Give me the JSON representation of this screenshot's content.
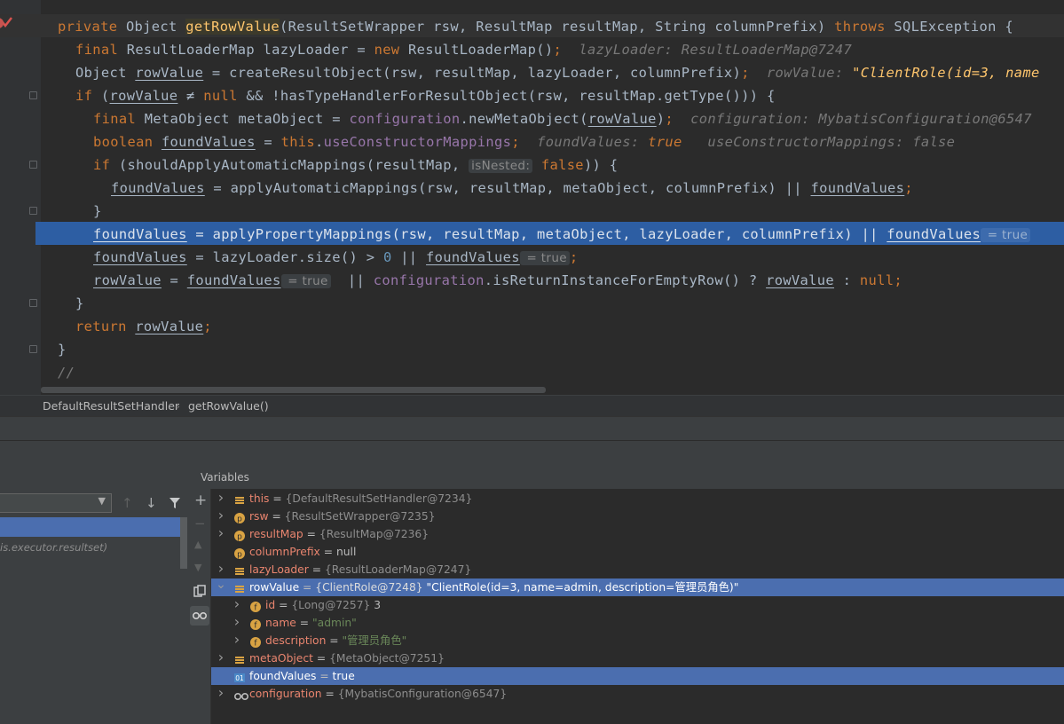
{
  "editor": {
    "lines": [
      {
        "id": "l1",
        "parts": [
          [
            "private ",
            "kw"
          ],
          [
            "Object ",
            ""
          ],
          [
            "getRowValue",
            "fn mbreak"
          ],
          [
            "(ResultSetWrapper rsw, ResultMap resultMap, String columnPrefix) ",
            ""
          ],
          [
            "throws ",
            "kw"
          ],
          [
            "SQLException {",
            ""
          ]
        ]
      },
      {
        "id": "l2",
        "parts": [
          [
            "final ",
            "kw"
          ],
          [
            "ResultLoaderMap lazyLoader = ",
            ""
          ],
          [
            "new ",
            "kw"
          ],
          [
            "ResultLoaderMap()",
            ""
          ],
          [
            ";",
            "kw"
          ],
          [
            "  lazyLoader: ResultLoaderMap@7247",
            "hint"
          ]
        ]
      },
      {
        "id": "l3",
        "parts": [
          [
            "Object ",
            ""
          ],
          [
            "rowValue",
            "u"
          ],
          [
            " = createResultObject(rsw, resultMap, lazyLoader, columnPrefix)",
            ""
          ],
          [
            ";",
            "kw"
          ],
          [
            "  rowValue: ",
            "hint"
          ],
          [
            "\"ClientRole(id=3, name",
            "hintstr"
          ]
        ]
      },
      {
        "id": "l4",
        "parts": [
          [
            "if ",
            "kw"
          ],
          [
            "(",
            ""
          ],
          [
            "rowValue",
            "u"
          ],
          [
            " ≠ ",
            ""
          ],
          [
            "null ",
            "kw"
          ],
          [
            "&& !hasTypeHandlerForResultObject(rsw, resultMap.getType())) {",
            ""
          ]
        ]
      },
      {
        "id": "l5",
        "parts": [
          [
            "final ",
            "kw"
          ],
          [
            "MetaObject metaObject = ",
            ""
          ],
          [
            "configuration",
            "fld"
          ],
          [
            ".newMetaObject(",
            ""
          ],
          [
            "rowValue",
            "u"
          ],
          [
            ")",
            ""
          ],
          [
            ";",
            "kw"
          ],
          [
            "  configuration: MybatisConfiguration@6547",
            "hint"
          ]
        ]
      },
      {
        "id": "l6",
        "parts": [
          [
            "boolean ",
            "kw"
          ],
          [
            "foundValues",
            "u"
          ],
          [
            " = ",
            ""
          ],
          [
            "this",
            "kw"
          ],
          [
            ".",
            ""
          ],
          [
            "useConstructorMappings",
            "fld"
          ],
          [
            ";",
            "kw"
          ],
          [
            "  foundValues: ",
            "hint"
          ],
          [
            "true",
            "hintval"
          ],
          [
            "   useConstructorMappings: false",
            "hint"
          ]
        ]
      },
      {
        "id": "l7",
        "parts": [
          [
            "if ",
            "kw"
          ],
          [
            "(shouldApplyAutomaticMappings(resultMap, ",
            ""
          ],
          [
            "isNested:",
            "pill"
          ],
          [
            " ",
            ""
          ],
          [
            "false",
            "kw"
          ],
          [
            ")) {",
            ""
          ]
        ]
      },
      {
        "id": "l8",
        "parts": [
          [
            "foundValues",
            "u"
          ],
          [
            " = applyAutomaticMappings(rsw, resultMap, metaObject, columnPrefix) || ",
            ""
          ],
          [
            "foundValues",
            "u"
          ],
          [
            ";",
            "kw"
          ]
        ]
      },
      {
        "id": "l9",
        "parts": [
          [
            "}",
            ""
          ]
        ]
      },
      {
        "id": "l10",
        "parts": [
          [
            "foundValues",
            "u"
          ],
          [
            " = applyPropertyMappings(rsw, resultMap, metaObject, lazyLoader, columnPrefix) || ",
            ""
          ],
          [
            "foundValues",
            "u"
          ],
          [
            " = true",
            "hl-pill"
          ]
        ]
      },
      {
        "id": "l11",
        "parts": [
          [
            "foundValues",
            "u"
          ],
          [
            " = lazyLoader.size() > ",
            ""
          ],
          [
            "0",
            "num"
          ],
          [
            " || ",
            ""
          ],
          [
            "foundValues",
            "u"
          ],
          [
            " = true",
            "pill"
          ],
          [
            ";",
            "kw"
          ]
        ]
      },
      {
        "id": "l12",
        "parts": [
          [
            "rowValue",
            "u"
          ],
          [
            " = ",
            ""
          ],
          [
            "foundValues",
            "u"
          ],
          [
            " = true",
            "pill"
          ],
          [
            "  || ",
            ""
          ],
          [
            "configuration",
            "fld"
          ],
          [
            ".isReturnInstanceForEmptyRow() ? ",
            ""
          ],
          [
            "rowValue",
            "u"
          ],
          [
            " : ",
            ""
          ],
          [
            "null",
            "kw"
          ],
          [
            ";",
            "kw"
          ]
        ]
      },
      {
        "id": "l13",
        "parts": [
          [
            "}",
            ""
          ]
        ]
      },
      {
        "id": "l14",
        "parts": [
          [
            "return ",
            "kw"
          ],
          [
            "rowValue",
            "u"
          ],
          [
            ";",
            "kw"
          ]
        ]
      },
      {
        "id": "l15",
        "parts": [
          [
            "}",
            ""
          ]
        ]
      },
      {
        "id": "l16",
        "parts": [
          [
            "//",
            "hint"
          ]
        ]
      }
    ]
  },
  "breadcrumb": {
    "class_name": "DefaultResultSetHandler",
    "separator": "›",
    "method_name": "getRowValue()"
  },
  "frames": {
    "frame_package": "is.executor.resultset)"
  },
  "variables": {
    "header": "Variables",
    "rows": [
      {
        "name": "this",
        "eq": " = ",
        "type": "{DefaultResultSetHandler@7234}",
        "value": "",
        "icon": "field",
        "expand": "›",
        "indent": 0
      },
      {
        "name": "rsw",
        "eq": " = ",
        "type": "{ResultSetWrapper@7235}",
        "value": "",
        "icon": "param",
        "expand": "›",
        "indent": 0
      },
      {
        "name": "resultMap",
        "eq": " = ",
        "type": "{ResultMap@7236}",
        "value": "",
        "icon": "param",
        "expand": "›",
        "indent": 0
      },
      {
        "name": "columnPrefix",
        "eq": " = ",
        "type": "",
        "value": "null",
        "icon": "param",
        "expand": "",
        "indent": 0
      },
      {
        "name": "lazyLoader",
        "eq": " = ",
        "type": "{ResultLoaderMap@7247}",
        "value": "",
        "icon": "field",
        "expand": "›",
        "indent": 0
      },
      {
        "name": "rowValue",
        "eq": " = ",
        "type": "{ClientRole@7248}",
        "value": " \"ClientRole(id=3, name=admin, description=管理员角色)\"",
        "icon": "field",
        "expand": "⌄",
        "indent": 0,
        "selected": true
      },
      {
        "name": "id",
        "eq": " = ",
        "type": "{Long@7257}",
        "value": " 3",
        "icon": "f",
        "expand": "›",
        "indent": 1
      },
      {
        "name": "name",
        "eq": " = ",
        "type": "",
        "value": "\"admin\"",
        "icon": "f",
        "expand": "›",
        "indent": 1,
        "str": true
      },
      {
        "name": "description",
        "eq": " = ",
        "type": "",
        "value": "\"管理员角色\"",
        "icon": "f",
        "expand": "›",
        "indent": 1,
        "str": true
      },
      {
        "name": "metaObject",
        "eq": " = ",
        "type": "{MetaObject@7251}",
        "value": "",
        "icon": "field",
        "expand": "›",
        "indent": 0
      },
      {
        "name": "foundValues",
        "eq": " = ",
        "type": "",
        "value": "true",
        "icon": "bool",
        "expand": "",
        "indent": 0,
        "selected": true
      },
      {
        "name": "configuration",
        "eq": " = ",
        "type": "{MybatisConfiguration@6547}",
        "value": "",
        "icon": "watch",
        "expand": "›",
        "indent": 0
      }
    ]
  },
  "colors": {
    "accent_selection": "#4b6eaf",
    "editor_highlight": "#2d5ea3",
    "keyword": "#cc7832",
    "method": "#ffc66d",
    "field": "#9876aa"
  }
}
